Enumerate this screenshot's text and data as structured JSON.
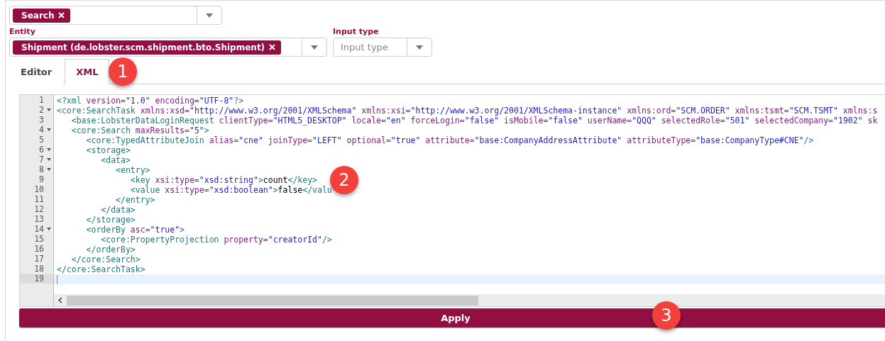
{
  "task_select": {
    "chips": [
      "Search"
    ]
  },
  "entity": {
    "label": "Entity",
    "chips": [
      "Shipment (de.lobster.scm.shipment.bto.Shipment)"
    ]
  },
  "input_type": {
    "label": "Input type",
    "placeholder": "Input type"
  },
  "tabs": [
    {
      "label": "Editor",
      "selected": false
    },
    {
      "label": "XML",
      "selected": true
    }
  ],
  "editor": {
    "lines": [
      {
        "number": "1",
        "fold": false,
        "current": false,
        "tokens": [
          {
            "kind": "tag",
            "text": "<?xml"
          },
          {
            "kind": "attr",
            "text": " version="
          },
          {
            "kind": "value",
            "text": "\"1.0\""
          },
          {
            "kind": "attr",
            "text": " encoding="
          },
          {
            "kind": "value",
            "text": "\"UTF-8\""
          },
          {
            "kind": "tag",
            "text": "?>"
          }
        ]
      },
      {
        "number": "2",
        "fold": true,
        "current": false,
        "tokens": [
          {
            "kind": "tag",
            "text": "<core:SearchTask"
          },
          {
            "kind": "attr",
            "text": " xmlns:xsd="
          },
          {
            "kind": "value",
            "text": "\"http://www.w3.org/2001/XMLSchema\""
          },
          {
            "kind": "attr",
            "text": " xmlns:xsi="
          },
          {
            "kind": "value",
            "text": "\"http://www.w3.org/2001/XMLSchema-instance\""
          },
          {
            "kind": "attr",
            "text": " xmlns:ord="
          },
          {
            "kind": "value",
            "text": "\"SCM.ORDER\""
          },
          {
            "kind": "attr",
            "text": " xmlns:tsmt="
          },
          {
            "kind": "value",
            "text": "\"SCM.TSMT\""
          },
          {
            "kind": "attr",
            "text": " xmlns:s"
          }
        ]
      },
      {
        "number": "3",
        "fold": false,
        "current": false,
        "tokens": [
          {
            "kind": "tag",
            "text": "   <base:LobsterDataLoginRequest"
          },
          {
            "kind": "attr",
            "text": " clientType="
          },
          {
            "kind": "value",
            "text": "\"HTML5_DESKTOP\""
          },
          {
            "kind": "attr",
            "text": " locale="
          },
          {
            "kind": "value",
            "text": "\"en\""
          },
          {
            "kind": "attr",
            "text": " forceLogin="
          },
          {
            "kind": "value",
            "text": "\"false\""
          },
          {
            "kind": "attr",
            "text": " isMobile="
          },
          {
            "kind": "value",
            "text": "\"false\""
          },
          {
            "kind": "attr",
            "text": " userName="
          },
          {
            "kind": "value",
            "text": "\"QQQ\""
          },
          {
            "kind": "attr",
            "text": " selectedRole="
          },
          {
            "kind": "value",
            "text": "\"501\""
          },
          {
            "kind": "attr",
            "text": " selectedCompany="
          },
          {
            "kind": "value",
            "text": "\"1902\""
          },
          {
            "kind": "attr",
            "text": " sk"
          }
        ]
      },
      {
        "number": "4",
        "fold": true,
        "current": false,
        "tokens": [
          {
            "kind": "tag",
            "text": "   <core:Search"
          },
          {
            "kind": "attr",
            "text": " maxResults="
          },
          {
            "kind": "value",
            "text": "\"5\""
          },
          {
            "kind": "tag",
            "text": ">"
          }
        ]
      },
      {
        "number": "5",
        "fold": false,
        "current": false,
        "tokens": [
          {
            "kind": "tag",
            "text": "      <core:TypedAttributeJoin"
          },
          {
            "kind": "attr",
            "text": " alias="
          },
          {
            "kind": "value",
            "text": "\"cne\""
          },
          {
            "kind": "attr",
            "text": " joinType="
          },
          {
            "kind": "value",
            "text": "\"LEFT\""
          },
          {
            "kind": "attr",
            "text": " optional="
          },
          {
            "kind": "value",
            "text": "\"true\""
          },
          {
            "kind": "attr",
            "text": " attribute="
          },
          {
            "kind": "value",
            "text": "\"base:CompanyAddressAttribute\""
          },
          {
            "kind": "attr",
            "text": " attributeType="
          },
          {
            "kind": "value",
            "text": "\"base:CompanyType#CNE\""
          },
          {
            "kind": "tag",
            "text": "/>"
          }
        ]
      },
      {
        "number": "6",
        "fold": true,
        "current": false,
        "tokens": [
          {
            "kind": "tag",
            "text": "      <storage>"
          }
        ]
      },
      {
        "number": "7",
        "fold": true,
        "current": false,
        "tokens": [
          {
            "kind": "tag",
            "text": "         <data>"
          }
        ]
      },
      {
        "number": "8",
        "fold": true,
        "current": false,
        "tokens": [
          {
            "kind": "tag",
            "text": "            <entry>"
          }
        ]
      },
      {
        "number": "9",
        "fold": false,
        "current": false,
        "tokens": [
          {
            "kind": "tag",
            "text": "               <key"
          },
          {
            "kind": "attr",
            "text": " xsi:type="
          },
          {
            "kind": "value",
            "text": "\"xsd:string\""
          },
          {
            "kind": "tag",
            "text": ">"
          },
          {
            "kind": "text",
            "text": "count"
          },
          {
            "kind": "tag",
            "text": "</key>"
          }
        ]
      },
      {
        "number": "10",
        "fold": false,
        "current": false,
        "tokens": [
          {
            "kind": "tag",
            "text": "               <value"
          },
          {
            "kind": "attr",
            "text": " xsi:type="
          },
          {
            "kind": "value",
            "text": "\"xsd:boolean\""
          },
          {
            "kind": "tag",
            "text": ">"
          },
          {
            "kind": "text",
            "text": "false"
          },
          {
            "kind": "tag",
            "text": "</valu"
          }
        ]
      },
      {
        "number": "11",
        "fold": false,
        "current": false,
        "tokens": [
          {
            "kind": "tag",
            "text": "            </entry>"
          }
        ]
      },
      {
        "number": "12",
        "fold": false,
        "current": false,
        "tokens": [
          {
            "kind": "tag",
            "text": "         </data>"
          }
        ]
      },
      {
        "number": "13",
        "fold": false,
        "current": false,
        "tokens": [
          {
            "kind": "tag",
            "text": "      </storage>"
          }
        ]
      },
      {
        "number": "14",
        "fold": true,
        "current": false,
        "tokens": [
          {
            "kind": "tag",
            "text": "      <orderBy"
          },
          {
            "kind": "attr",
            "text": " asc="
          },
          {
            "kind": "value",
            "text": "\"true\""
          },
          {
            "kind": "tag",
            "text": ">"
          }
        ]
      },
      {
        "number": "15",
        "fold": false,
        "current": false,
        "tokens": [
          {
            "kind": "tag",
            "text": "         <core:PropertyProjection"
          },
          {
            "kind": "attr",
            "text": " property="
          },
          {
            "kind": "value",
            "text": "\"creatorId\""
          },
          {
            "kind": "tag",
            "text": "/>"
          }
        ]
      },
      {
        "number": "16",
        "fold": false,
        "current": false,
        "tokens": [
          {
            "kind": "tag",
            "text": "      </orderBy>"
          }
        ]
      },
      {
        "number": "17",
        "fold": false,
        "current": false,
        "tokens": [
          {
            "kind": "tag",
            "text": "   </core:Search>"
          }
        ]
      },
      {
        "number": "18",
        "fold": false,
        "current": false,
        "tokens": [
          {
            "kind": "tag",
            "text": "</core:SearchTask>"
          }
        ]
      },
      {
        "number": "19",
        "fold": false,
        "current": true
      }
    ]
  },
  "apply_button": {
    "label": "Apply"
  },
  "annotations": [
    {
      "label": "1"
    },
    {
      "label": "2"
    },
    {
      "label": "3"
    }
  ]
}
